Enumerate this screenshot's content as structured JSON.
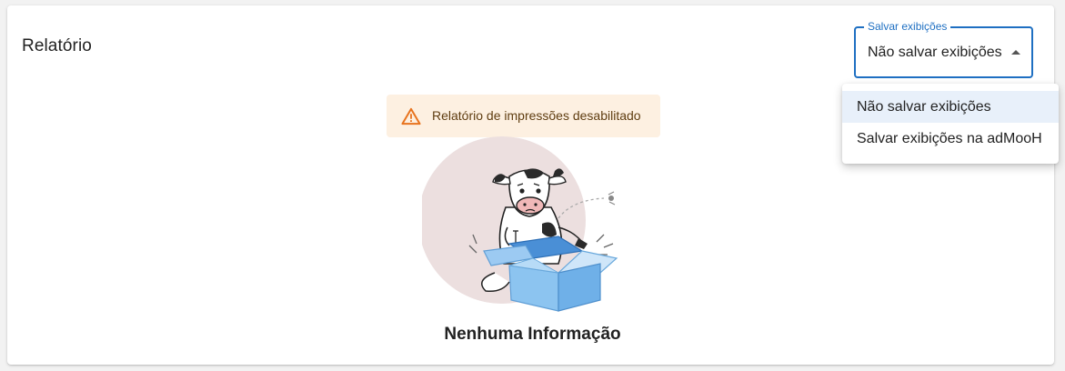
{
  "report": {
    "title": "Relatório"
  },
  "save_select": {
    "legend": "Salvar exibições",
    "value": "Não salvar exibições",
    "options": [
      {
        "label": "Não salvar exibições",
        "selected": true
      },
      {
        "label": "Salvar exibições na adMooH",
        "selected": false
      }
    ]
  },
  "warning": {
    "icon": "warning-triangle-icon",
    "text": "Relatório de impressões desabilitado"
  },
  "empty_state": {
    "illustration": "cow-empty-box-illustration",
    "label": "Nenhuma Informação"
  },
  "colors": {
    "accent": "#1e6fc2",
    "warning_bg": "#fdf0e1",
    "warning_icon": "#e8731e",
    "selected_option_bg": "#e8f0fa"
  }
}
